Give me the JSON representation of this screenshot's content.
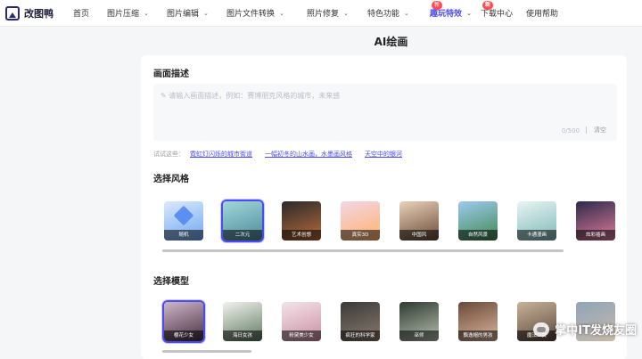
{
  "brand": {
    "name": "改图鸭"
  },
  "nav": [
    {
      "label": "首页",
      "has_menu": false
    },
    {
      "label": "图片压缩",
      "has_menu": true
    },
    {
      "label": "图片编辑",
      "has_menu": true
    },
    {
      "label": "图片文件转换",
      "has_menu": true
    },
    {
      "label": "照片修复",
      "has_menu": true
    },
    {
      "label": "特色功能",
      "has_menu": true,
      "badge": "新"
    },
    {
      "label": "趣玩特效",
      "has_menu": true,
      "badge": "新",
      "active": true
    },
    {
      "label": "下载中心",
      "has_menu": false
    },
    {
      "label": "使用帮助",
      "has_menu": false
    }
  ],
  "page": {
    "title": "AI绘画"
  },
  "prompt": {
    "section_title": "画面描述",
    "placeholder": "请输入画面描述，例如：赛博朋克风格的城市，未来感",
    "count": "0/500",
    "clear_label": "清空"
  },
  "examples": {
    "label": "试试这些：",
    "items": [
      "霓虹灯闪烁的城市街道",
      "一幅初冬的山水画，水墨画风格",
      "天空中的银河"
    ]
  },
  "styles": {
    "section_title": "选择风格",
    "items": [
      {
        "label": "随机",
        "colors": [
          "#dbe9fb",
          "#6fa8f3"
        ],
        "selected": false
      },
      {
        "label": "二次元",
        "colors": [
          "#9fd7d9",
          "#4f8a9a"
        ],
        "selected": true
      },
      {
        "label": "艺术创想",
        "colors": [
          "#2a2a2a",
          "#b86a3a"
        ],
        "selected": false
      },
      {
        "label": "真实3D",
        "colors": [
          "#f3d6e6",
          "#ffb26b"
        ],
        "selected": false
      },
      {
        "label": "中国风",
        "colors": [
          "#e9d2b8",
          "#6b4a3a"
        ],
        "selected": false
      },
      {
        "label": "自然风景",
        "colors": [
          "#9fcaf0",
          "#3f8a4f"
        ],
        "selected": false
      },
      {
        "label": "卡通漫画",
        "colors": [
          "#e8f4f4",
          "#7fb8b8"
        ],
        "selected": false
      },
      {
        "label": "炫彩插画",
        "colors": [
          "#2c2a4a",
          "#e07a9a"
        ],
        "selected": false
      }
    ]
  },
  "models": {
    "section_title": "选择模型",
    "items": [
      {
        "label": "樱花少女",
        "colors": [
          "#cdb7c9",
          "#4a2f3f"
        ],
        "selected": true
      },
      {
        "label": "海日女孩",
        "colors": [
          "#f2f2ee",
          "#5e7a5e"
        ],
        "selected": false
      },
      {
        "label": "粉黛美少女",
        "colors": [
          "#f4e4ea",
          "#c98ea3"
        ],
        "selected": false
      },
      {
        "label": "疯狂的科学家",
        "colors": [
          "#3a3a3a",
          "#8a7a6a"
        ],
        "selected": false
      },
      {
        "label": "巫师",
        "colors": [
          "#2f3a30",
          "#b6c0b0"
        ],
        "selected": false
      },
      {
        "label": "飘逸帽的男孩",
        "colors": [
          "#6a4a3a",
          "#d9b59a"
        ],
        "selected": false
      },
      {
        "label": "魔法少女",
        "colors": [
          "#c9b29a",
          "#5a4a3a"
        ],
        "selected": false
      },
      {
        "label": "",
        "colors": [
          "#8fa5b8",
          "#c8b8a8"
        ],
        "selected": false
      }
    ]
  },
  "watermark": "掌中IT发烧友圈"
}
